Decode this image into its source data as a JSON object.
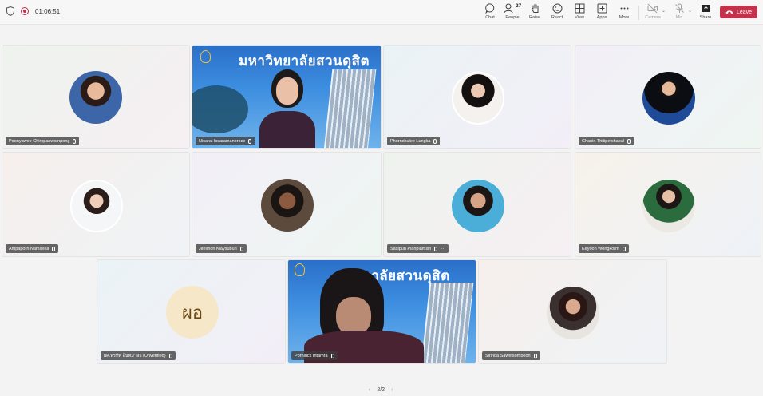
{
  "meeting": {
    "timer": "01:06:51"
  },
  "toolbar": {
    "chat": "Chat",
    "people": "People",
    "people_count": "27",
    "raise": "Raise",
    "react": "React",
    "view": "View",
    "apps": "Apps",
    "more": "More",
    "camera": "Camera",
    "mic": "Mic",
    "share": "Share",
    "leave": "Leave"
  },
  "video_banner": "มหาวิทยาลัยสวนดุสิต",
  "video_banner_cropped": "วิทยาลัยสวนดุสิต",
  "participants": [
    {
      "name": "Poonyawee Chiropaswornpong"
    },
    {
      "name": "Nisarat Issaramanorose"
    },
    {
      "name": "Phornchulee Lungka"
    },
    {
      "name": "Chanin Thitipetchakul"
    },
    {
      "name": "Ampaporn Namsena"
    },
    {
      "name": "Jiteimon Klaysubun"
    },
    {
      "name": "Sasipun Pianpiamsin"
    },
    {
      "name": "Keyoon Wongkorm"
    },
    {
      "name": "ผศ.พรทิพ อินทมาลย (Unverified)",
      "initials": "ผอ"
    },
    {
      "name": "Pornluck Intamra"
    },
    {
      "name": "Sirinda Sawetsomboon"
    }
  ],
  "pager": {
    "label": "2/2"
  },
  "colors": {
    "leave_bg": "#c4314b",
    "video_blue": "#2a6fc9",
    "initials_bg": "#f7e7c9"
  }
}
